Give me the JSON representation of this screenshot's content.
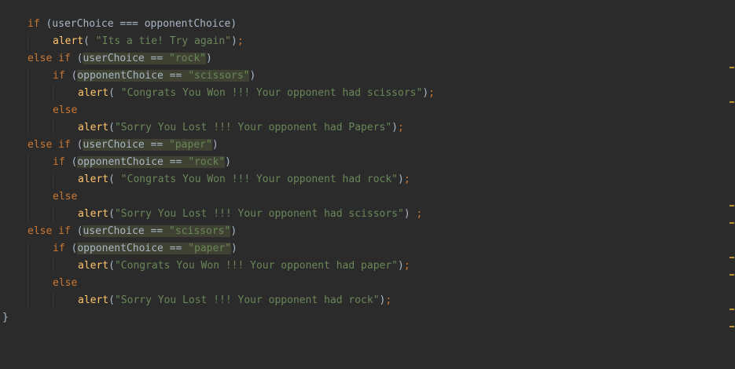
{
  "lines": [
    {
      "indent": 1,
      "tokens": [
        {
          "t": "kw",
          "v": "if "
        },
        {
          "t": "plain",
          "v": "(userChoice === opponentChoice)"
        }
      ]
    },
    {
      "indent": 2,
      "tokens": [
        {
          "t": "fn",
          "v": "alert"
        },
        {
          "t": "plain",
          "v": "( "
        },
        {
          "t": "str",
          "v": "\"Its a tie! Try again\""
        },
        {
          "t": "plain",
          "v": ")"
        },
        {
          "t": "kw",
          "v": ";"
        }
      ]
    },
    {
      "indent": 1,
      "tokens": [
        {
          "t": "kw",
          "v": "else if "
        },
        {
          "t": "plain",
          "v": "("
        },
        {
          "t": "plain-hl",
          "v": "userChoice == "
        },
        {
          "t": "str-hl",
          "v": "\"rock\""
        },
        {
          "t": "plain",
          "v": ")"
        }
      ]
    },
    {
      "indent": 2,
      "tokens": [
        {
          "t": "kw",
          "v": "if "
        },
        {
          "t": "plain",
          "v": "("
        },
        {
          "t": "plain-hl",
          "v": "opponentChoice == "
        },
        {
          "t": "str-hl",
          "v": "\"scissors\""
        },
        {
          "t": "plain",
          "v": ")"
        }
      ]
    },
    {
      "indent": 3,
      "tokens": [
        {
          "t": "fn",
          "v": "alert"
        },
        {
          "t": "plain",
          "v": "( "
        },
        {
          "t": "str",
          "v": "\"Congrats You Won !!! Your opponent had scissors\""
        },
        {
          "t": "plain",
          "v": ")"
        },
        {
          "t": "kw",
          "v": ";"
        }
      ]
    },
    {
      "indent": 2,
      "tokens": [
        {
          "t": "kw",
          "v": "else"
        }
      ]
    },
    {
      "indent": 3,
      "tokens": [
        {
          "t": "fn",
          "v": "alert"
        },
        {
          "t": "plain",
          "v": "("
        },
        {
          "t": "str",
          "v": "\"Sorry You Lost !!! Your opponent had Papers\""
        },
        {
          "t": "plain",
          "v": ")"
        },
        {
          "t": "kw",
          "v": ";"
        }
      ]
    },
    {
      "indent": 1,
      "tokens": [
        {
          "t": "kw",
          "v": "else if "
        },
        {
          "t": "plain",
          "v": "("
        },
        {
          "t": "plain-hl",
          "v": "userChoice == "
        },
        {
          "t": "str-hl",
          "v": "\"paper\""
        },
        {
          "t": "plain",
          "v": ")"
        }
      ]
    },
    {
      "indent": 2,
      "tokens": [
        {
          "t": "kw",
          "v": "if "
        },
        {
          "t": "plain",
          "v": "("
        },
        {
          "t": "plain-hl",
          "v": "opponentChoice == "
        },
        {
          "t": "str-hl",
          "v": "\"rock\""
        },
        {
          "t": "plain",
          "v": ")"
        }
      ]
    },
    {
      "indent": 3,
      "tokens": [
        {
          "t": "fn",
          "v": "alert"
        },
        {
          "t": "plain",
          "v": "( "
        },
        {
          "t": "str",
          "v": "\"Congrats You Won !!! Your opponent had rock\""
        },
        {
          "t": "plain",
          "v": ")"
        },
        {
          "t": "kw",
          "v": ";"
        }
      ]
    },
    {
      "indent": 2,
      "tokens": [
        {
          "t": "kw",
          "v": "else"
        }
      ]
    },
    {
      "indent": 3,
      "tokens": [
        {
          "t": "fn",
          "v": "alert"
        },
        {
          "t": "plain",
          "v": "("
        },
        {
          "t": "str",
          "v": "\"Sorry You Lost !!! Your opponent had scissors\""
        },
        {
          "t": "plain",
          "v": ") "
        },
        {
          "t": "kw",
          "v": ";"
        }
      ]
    },
    {
      "indent": 1,
      "tokens": [
        {
          "t": "kw",
          "v": "else if "
        },
        {
          "t": "plain",
          "v": "("
        },
        {
          "t": "plain-hl",
          "v": "userChoice == "
        },
        {
          "t": "str-hl",
          "v": "\"scissors\""
        },
        {
          "t": "plain",
          "v": ")"
        }
      ]
    },
    {
      "indent": 2,
      "tokens": [
        {
          "t": "kw",
          "v": "if "
        },
        {
          "t": "plain",
          "v": "("
        },
        {
          "t": "plain-hl",
          "v": "opponentChoice == "
        },
        {
          "t": "str-hl",
          "v": "\"paper\""
        },
        {
          "t": "plain",
          "v": ")"
        }
      ]
    },
    {
      "indent": 3,
      "tokens": [
        {
          "t": "fn",
          "v": "alert"
        },
        {
          "t": "plain",
          "v": "("
        },
        {
          "t": "str",
          "v": "\"Congrats You Won !!! Your opponent had paper\""
        },
        {
          "t": "plain",
          "v": ")"
        },
        {
          "t": "kw",
          "v": ";"
        }
      ]
    },
    {
      "indent": 2,
      "tokens": [
        {
          "t": "kw",
          "v": "else"
        }
      ]
    },
    {
      "indent": 3,
      "tokens": [
        {
          "t": "fn",
          "v": "alert"
        },
        {
          "t": "plain",
          "v": "("
        },
        {
          "t": "str",
          "v": "\"Sorry You Lost !!! Your opponent had rock\""
        },
        {
          "t": "plain",
          "v": ")"
        },
        {
          "t": "kw",
          "v": ";"
        }
      ]
    },
    {
      "indent": 0,
      "tokens": [
        {
          "t": "plain",
          "v": "}"
        }
      ]
    }
  ],
  "colors": {
    "background": "#2b2b2b",
    "keyword": "#cc7832",
    "function": "#ffc66d",
    "string": "#6a8759",
    "plain": "#a9b7c6",
    "highlight": "#3f4132",
    "marker": "#b8912e"
  },
  "scrollbar_marker_lines": [
    3,
    5,
    11,
    12,
    14,
    15,
    17,
    18
  ]
}
